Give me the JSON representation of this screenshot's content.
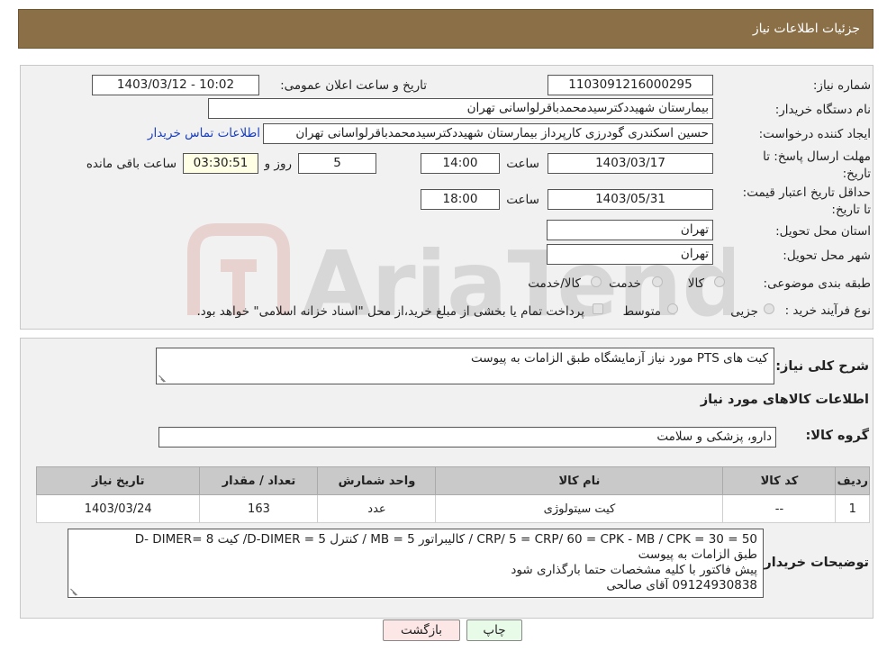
{
  "header": {
    "title": "جزئیات اطلاعات نیاز"
  },
  "info": {
    "need_number_label": "شماره نیاز:",
    "need_number": "1103091216000295",
    "announce_label": "تاریخ و ساعت اعلان عمومی:",
    "announce_value": "1403/03/12 - 10:02",
    "buyer_org_label": "نام دستگاه خریدار:",
    "buyer_org": "بیمارستان شهیددکترسیدمحمدباقرلواسانی تهران",
    "requester_label": "ایجاد کننده درخواست:",
    "requester": "حسین اسکندری گودرزی کارپرداز بیمارستان شهیددکترسیدمحمدباقرلواسانی تهران",
    "contact_link": "اطلاعات تماس خریدار",
    "deadline_label": "مهلت ارسال پاسخ: تا تاریخ:",
    "deadline_date": "1403/03/17",
    "time_word": "ساعت",
    "deadline_time": "14:00",
    "days_value": "5",
    "days_word": "روز و",
    "remaining_time": "03:30:51",
    "remaining_label": "ساعت باقی مانده",
    "price_validity_label": "حداقل تاریخ اعتبار قیمت: تا تاریخ:",
    "price_validity_date": "1403/05/31",
    "price_validity_time": "18:00",
    "province_label": "استان محل تحویل:",
    "province": "تهران",
    "city_label": "شهر محل تحویل:",
    "city": "تهران",
    "category_label": "طبقه بندی موضوعی:",
    "category_options": [
      "کالا",
      "خدمت",
      "کالا/خدمت"
    ],
    "process_label": "نوع فرآیند خرید :",
    "process_options": [
      "جزیی",
      "متوسط"
    ],
    "process_note": "پرداخت تمام یا بخشی از مبلغ خرید،از محل \"اسناد خزانه اسلامی\" خواهد بود."
  },
  "description": {
    "label": "شرح کلی نیاز:",
    "value": "کیت های PTS مورد نیاز آزمایشگاه طبق الزامات به پیوست"
  },
  "goods": {
    "section_title": "اطلاعات کالاهای مورد نیاز",
    "group_label": "گروه کالا:",
    "group_value": "دارو، پزشکی و سلامت",
    "columns": [
      "ردیف",
      "کد کالا",
      "نام کالا",
      "واحد شمارش",
      "تعداد / مقدار",
      "تاریخ نیاز"
    ],
    "rows": [
      {
        "row": "1",
        "code": "--",
        "name": "کیت سیتولوژی",
        "unit": "عدد",
        "qty": "163",
        "date": "1403/03/24"
      }
    ]
  },
  "buyer_notes": {
    "label": "توضیحات خریدار:",
    "lines": [
      "50 = CRP/ 5 = CRP/ 60 = CPK - MB / CPK = 30 / کالیبراتور 5 = MB / کنترل 5 = D-DIMER/ کیت 8 =D- DIMER",
      "طبق الزامات به پیوست",
      "پیش فاکتور با کلیه مشخصات حتما بارگذاری شود",
      "09124930838 آقای صالحی"
    ]
  },
  "buttons": {
    "print": "چاپ",
    "back": "بازگشت"
  },
  "colors": {
    "header_bg": "#8b6f47",
    "link": "#1a3fbf",
    "panel_bg": "#f1f1f1",
    "back_btn": "#fde6e6",
    "print_btn": "#e8fbe8"
  }
}
